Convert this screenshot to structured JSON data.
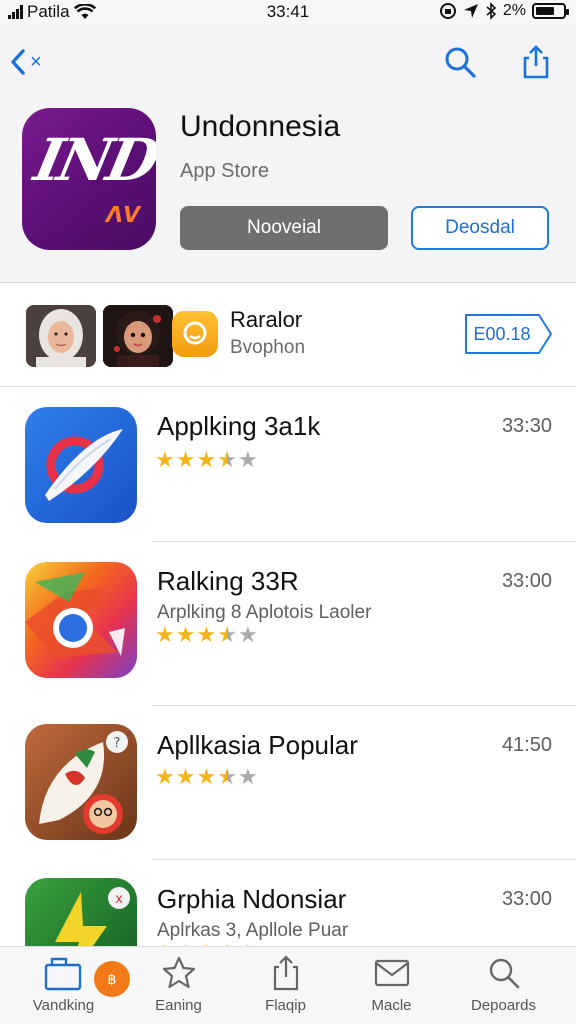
{
  "status_bar": {
    "carrier": "Patila",
    "time": "33:41",
    "battery_text": "2%",
    "battery_level": 0.7
  },
  "header": {
    "back_text": "×",
    "app_name": "Undonnesia",
    "store_label": "App Store",
    "icon_text": "IND",
    "primary_button": "Nooveial",
    "secondary_button": "Deosdal",
    "icons": [
      "search-icon",
      "share-icon"
    ]
  },
  "featured": {
    "title": "Raralor",
    "subtitle": "Bvophon",
    "button": "E00.18"
  },
  "list": [
    {
      "title": "Applking 3a1k",
      "subtitle": "",
      "time": "33:30",
      "rating": 3.5,
      "icon": "app-icon-blue-ring"
    },
    {
      "title": "Ralking 33R",
      "subtitle": "Arplking 8  Aplotois Laoler",
      "time": "33:00",
      "rating": 3.5,
      "icon": "app-icon-rainbow"
    },
    {
      "title": "Apllkasia Popular",
      "subtitle": "",
      "time": "41:50",
      "rating": 3.5,
      "icon": "app-icon-brown-leaf"
    },
    {
      "title": "Grphia Ndonsiar",
      "subtitle": "Aplrkas 3, Apllole Puar",
      "time": "33:00",
      "rating": 3.5,
      "icon": "app-icon-green-bolt"
    }
  ],
  "tabbar": {
    "badge": "฿",
    "tabs": [
      {
        "label": "Vandking",
        "icon": "today-icon"
      },
      {
        "label": "Eaning",
        "icon": "star-icon"
      },
      {
        "label": "Flaqip",
        "icon": "share-box-icon"
      },
      {
        "label": "Macle",
        "icon": "mail-icon"
      },
      {
        "label": "Depoards",
        "icon": "search-icon"
      }
    ]
  },
  "colors": {
    "accent": "#1f6fcf",
    "star": "#f3b51a",
    "app_icon": "#6a1483",
    "badge": "#f07a18"
  }
}
